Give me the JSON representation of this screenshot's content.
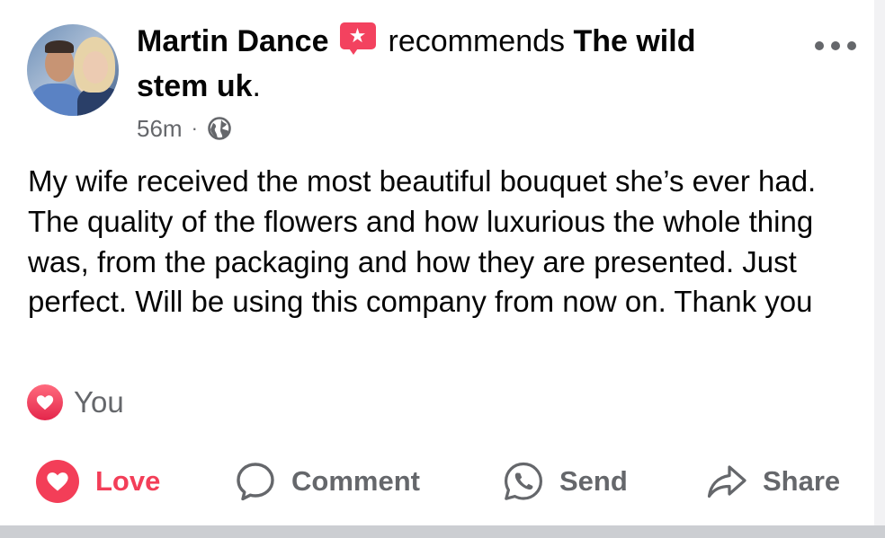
{
  "post": {
    "author": "Martin Dance",
    "action_text": "recommends",
    "page_name_line1": "The wild",
    "page_name_line2": "stem uk",
    "period": ".",
    "time": "56m",
    "separator": "·",
    "audience_icon": "globe-icon",
    "badge_icon": "recommend-star-icon",
    "more_icon": "more-options-icon",
    "body": "My wife received the most beautiful bouquet she’s ever had. The quality of the flowers and how luxurious the whole thing was, from the packaging and how they are presented. Just perfect. Will be using this company from now on. Thank you"
  },
  "reactions": {
    "icon": "love-reaction-icon",
    "names": "You"
  },
  "actions": {
    "love": "Love",
    "comment": "Comment",
    "send": "Send",
    "share": "Share"
  },
  "colors": {
    "love_red": "#f33e58",
    "badge_pink": "#f3425f",
    "secondary_text": "#65676b",
    "primary_text": "#050505"
  }
}
